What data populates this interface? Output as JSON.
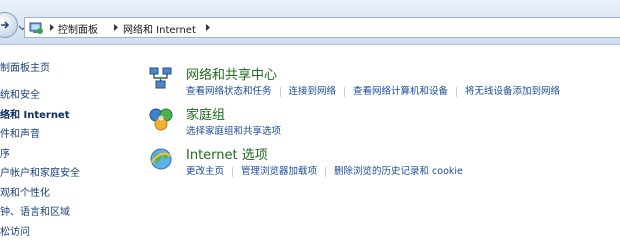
{
  "addressbar": {
    "crumbs": [
      "控制面板",
      "网络和 Internet"
    ]
  },
  "leftnav": {
    "items": [
      {
        "label": "制面板主页",
        "bold": false
      },
      {
        "label": "统和安全",
        "bold": false
      },
      {
        "label": "络和 Internet",
        "bold": true
      },
      {
        "label": "件和声音",
        "bold": false
      },
      {
        "label": "序",
        "bold": false
      },
      {
        "label": "户帐户和家庭安全",
        "bold": false
      },
      {
        "label": "观和个性化",
        "bold": false
      },
      {
        "label": "钟、语言和区域",
        "bold": false
      },
      {
        "label": "松访问",
        "bold": false
      }
    ]
  },
  "main": {
    "categories": [
      {
        "title": "网络和共享中心",
        "icon": "network-icon",
        "links": [
          "查看网络状态和任务",
          "连接到网络",
          "查看网络计算机和设备",
          "将无线设备添加到网络"
        ]
      },
      {
        "title": "家庭组",
        "icon": "homegroup-icon",
        "links": [
          "选择家庭组和共享选项"
        ]
      },
      {
        "title": "Internet 选项",
        "icon": "internet-options-icon",
        "links": [
          "更改主页",
          "管理浏览器加载项",
          "删除浏览的历史记录和 cookie"
        ]
      }
    ]
  }
}
